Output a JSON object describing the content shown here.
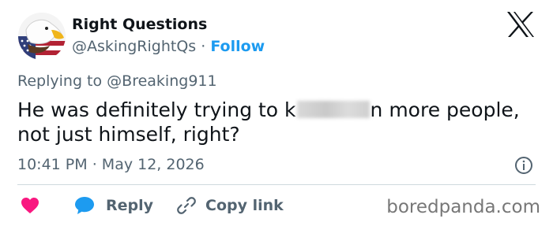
{
  "author": {
    "name": "Right Questions",
    "handle": "@AskingRightQs",
    "separator": "·",
    "follow_label": "Follow"
  },
  "reply_context": {
    "prefix": "Replying to",
    "mention": "@Breaking911"
  },
  "tweet": {
    "text_before_blur": "He was definitely trying to k",
    "text_after_blur": "n more people,",
    "text_line2": "not just himself, right?"
  },
  "meta": {
    "time": "10:41 PM",
    "separator": "·",
    "date": "May 12, 2026"
  },
  "actions": {
    "reply_label": "Reply",
    "copy_link_label": "Copy link"
  },
  "watermark": "boredpanda.com",
  "icons": {
    "platform_logo": "x-logo-icon",
    "like": "heart-icon",
    "reply": "speech-bubble-icon",
    "copy": "link-icon",
    "info": "info-icon"
  },
  "colors": {
    "accent": "#1d9bf0",
    "like": "#f91880",
    "text": "#0f1419",
    "muted": "#536471"
  }
}
